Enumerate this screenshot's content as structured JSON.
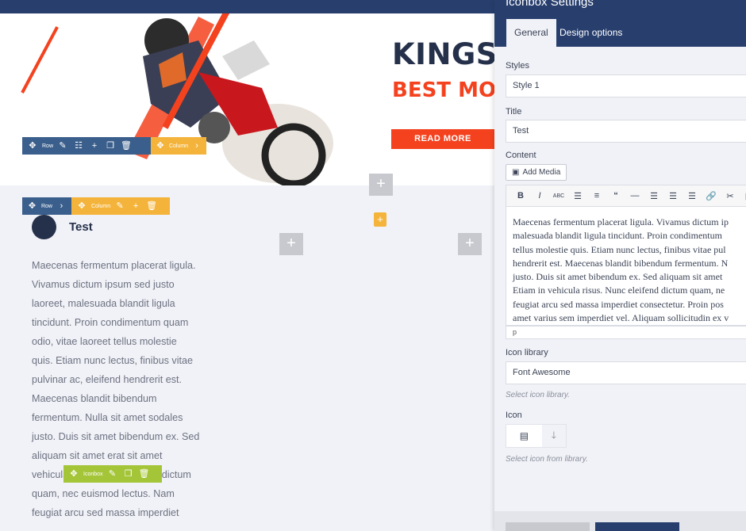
{
  "hero": {
    "title": "KINGS",
    "subtitle": "BEST MO",
    "button_label": "READ MORE"
  },
  "toolbars": {
    "row_label": "Row",
    "column_label": "Column",
    "iconbox_label": "Iconbox"
  },
  "content": {
    "iconbox_title": "Test",
    "body_text": "Maecenas fermentum placerat ligula. Vivamus dictum ipsum sed justo laoreet, malesuada blandit ligula tincidunt. Proin condimentum quam odio, vitae laoreet tellus molestie quis. Etiam nunc lectus, finibus vitae pulvinar ac, eleifend hendrerit est. Maecenas blandit bibendum fermentum. Nulla sit amet sodales justo. Duis sit amet bibendum ex. Sed aliquam sit amet erat sit amet vehicula risus. Nunc eleifend dictum quam, nec euismod lectus. Nam feugiat arcu sed massa imperdiet"
  },
  "panel": {
    "title": "Iconbox Settings",
    "tabs": [
      "General",
      "Design options"
    ],
    "styles_label": "Styles",
    "styles_value": "Style 1",
    "title_label": "Title",
    "title_value": "Test",
    "content_label": "Content",
    "add_media_label": "Add Media",
    "editor_lines": [
      "Maecenas fermentum placerat ligula. Vivamus dictum ip",
      "malesuada blandit ligula tincidunt. Proin condimentum",
      "tellus molestie quis. Etiam nunc lectus, finibus vitae pul",
      "hendrerit est. Maecenas blandit bibendum fermentum. N",
      "justo. Duis sit amet bibendum ex. Sed aliquam sit amet",
      "Etiam in vehicula risus. Nunc eleifend dictum quam, ne",
      "feugiat arcu sed massa imperdiet consectetur. Proin pos",
      "amet varius sem imperdiet vel. Aliquam sollicitudin ex v"
    ],
    "editor_status": "p",
    "icon_library_label": "Icon library",
    "icon_library_value": "Font Awesome",
    "icon_library_hint": "Select icon library.",
    "icon_label": "Icon",
    "icon_hint": "Select icon from library."
  },
  "colors": {
    "navy": "#283f6e",
    "accent": "#f4421f",
    "row_toolbar": "#3b5f8c",
    "column_toolbar": "#f4b43b",
    "iconbox_toolbar": "#a5c539"
  }
}
